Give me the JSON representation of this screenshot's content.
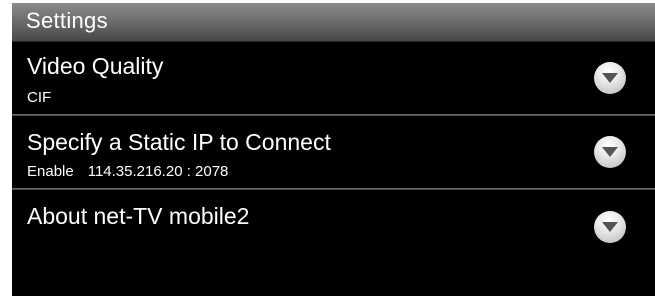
{
  "header": {
    "title": "Settings"
  },
  "items": [
    {
      "title": "Video Quality",
      "subtitle": "CIF",
      "icon": "chevron-down-icon"
    },
    {
      "title": "Specify a Static IP to Connect",
      "status": "Enable",
      "address": "114.35.216.20 : 2078",
      "icon": "chevron-down-icon"
    },
    {
      "title": "About net-TV mobile2",
      "icon": "chevron-down-icon"
    }
  ],
  "colors": {
    "background": "#000000",
    "text": "#ffffff",
    "title_bar": "#6e6e6e",
    "divider": "#7a7a7a",
    "button": "#e8e8e8",
    "chevron": "#555555"
  }
}
